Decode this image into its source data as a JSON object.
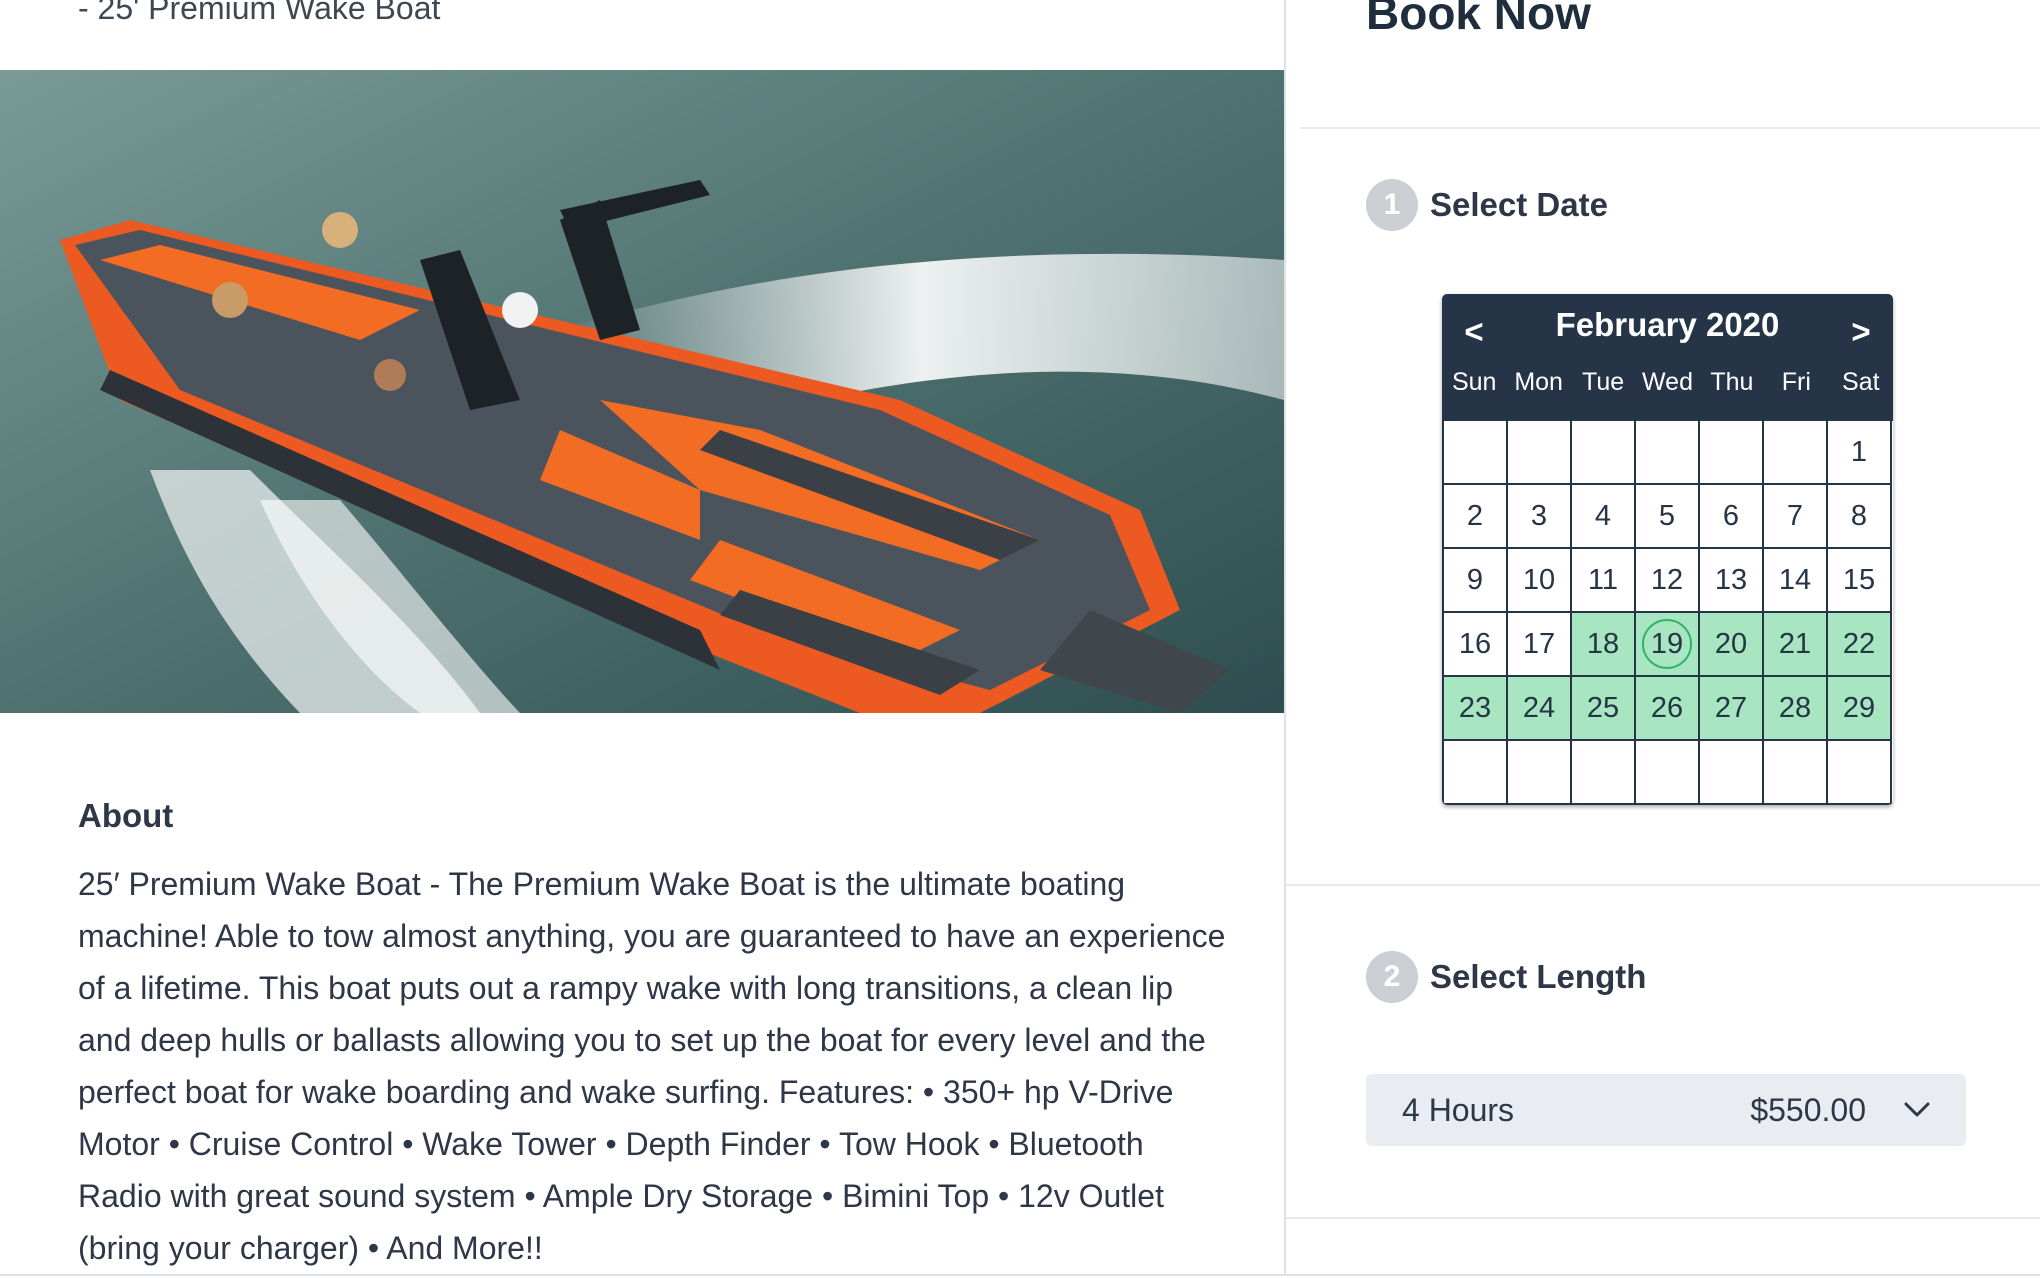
{
  "listing": {
    "subtitle": "- 25' Premium Wake Boat",
    "about_heading": "About",
    "about_text": "25′ Premium Wake Boat - The Premium Wake Boat is the ultimate boating machine! Able to tow almost anything, you are guaranteed to have an experience of a lifetime. This boat puts out a rampy wake with long transitions, a clean lip and deep hulls or ballasts allowing you to set up the boat for every level and the perfect boat for wake boarding and wake surfing. Features: • 350+ hp V-Drive Motor • Cruise Control • Wake Tower • Depth Finder • Tow Hook • Bluetooth Radio with great sound system • Ample Dry Storage • Bimini Top • 12v Outlet (bring your charger) • And More!!",
    "photo": "orange-wake-boat-photo"
  },
  "booking": {
    "title": "Book Now",
    "step1": {
      "number": "1",
      "label": "Select Date"
    },
    "step2": {
      "number": "2",
      "label": "Select Length"
    },
    "calendar": {
      "prev": "<",
      "next": ">",
      "month": "February 2020",
      "weekdays": [
        "Sun",
        "Mon",
        "Tue",
        "Wed",
        "Thu",
        "Fri",
        "Sat"
      ],
      "cells": [
        "",
        "",
        "",
        "",
        "",
        "",
        "1",
        "2",
        "3",
        "4",
        "5",
        "6",
        "7",
        "8",
        "9",
        "10",
        "11",
        "12",
        "13",
        "14",
        "15",
        "16",
        "17",
        "18",
        "19",
        "20",
        "21",
        "22",
        "23",
        "24",
        "25",
        "26",
        "27",
        "28",
        "29",
        "",
        "",
        "",
        "",
        "",
        "",
        ""
      ],
      "available": [
        "18",
        "19",
        "20",
        "21",
        "22",
        "23",
        "24",
        "25",
        "26",
        "27",
        "28",
        "29"
      ],
      "selected": "19"
    },
    "length": {
      "label": "4 Hours",
      "price": "$550.00"
    }
  },
  "colors": {
    "header": "#253447",
    "available": "#a8e6c1",
    "selected_ring": "#2fb26a",
    "step_badge": "#cbcfd3",
    "select_bg": "#e9edf1"
  }
}
